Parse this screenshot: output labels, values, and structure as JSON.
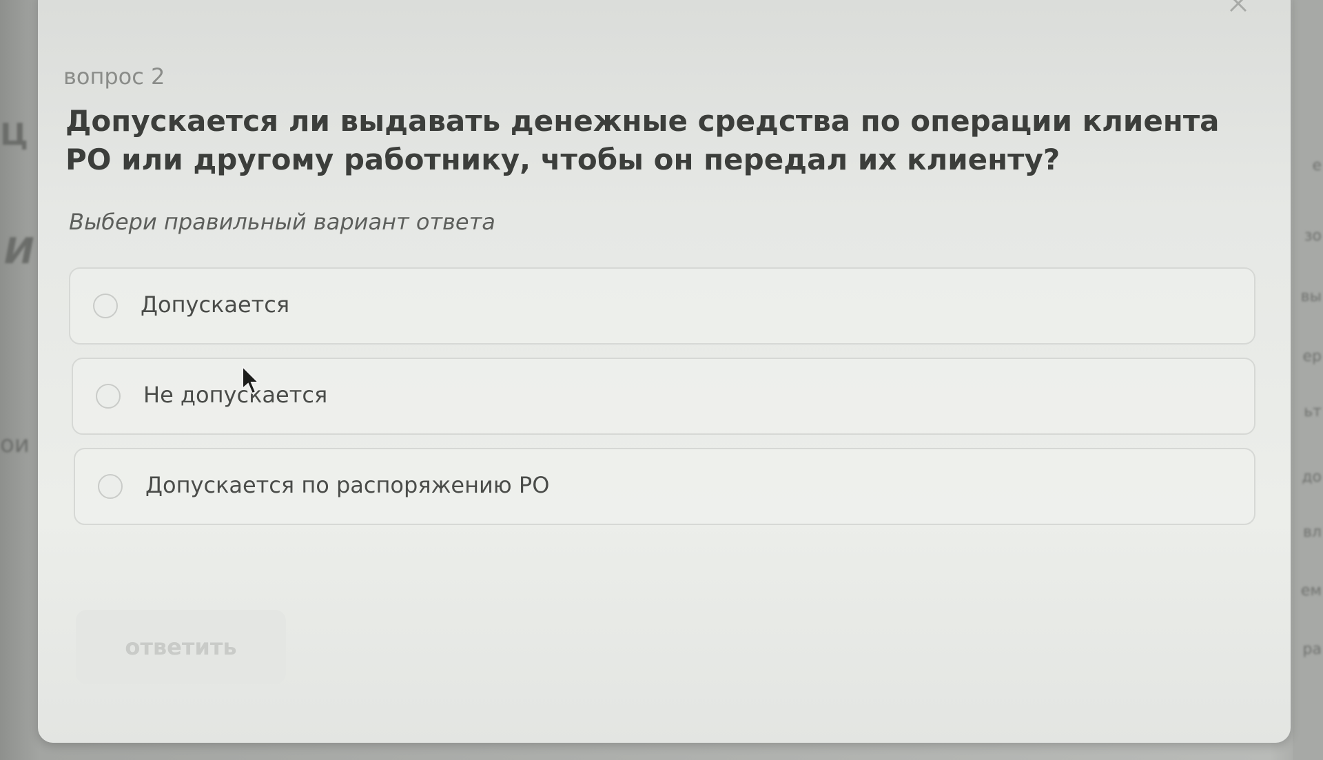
{
  "dialog": {
    "question_number": "вопрос 2",
    "question_text": "Допускается ли выдавать денежные средства по операции клиента РО или другому работнику, чтобы он передал их клиенту?",
    "instruction": "Выбери правильный вариант ответа",
    "options": [
      {
        "label": "Допускается",
        "selected": false
      },
      {
        "label": "Не допускается",
        "selected": false
      },
      {
        "label": "Допускается по распоряжению РО",
        "selected": false
      }
    ],
    "submit_label": "ответить",
    "submit_enabled": false,
    "close_icon": "close-icon"
  },
  "background": {
    "left_fragments": [
      "Ц",
      "И",
      "ои"
    ],
    "right_fragments": [
      "е",
      "зо",
      "вы",
      "ер",
      "ьт",
      "до",
      "вл",
      "ем",
      "ра"
    ]
  },
  "colors": {
    "overlay": "#a3a5a2",
    "dialog_bg": "#e6e8e5",
    "question_text": "#3c3e3b",
    "disabled_button_bg": "#e4e6e3",
    "disabled_button_text": "#c9cbc8"
  }
}
